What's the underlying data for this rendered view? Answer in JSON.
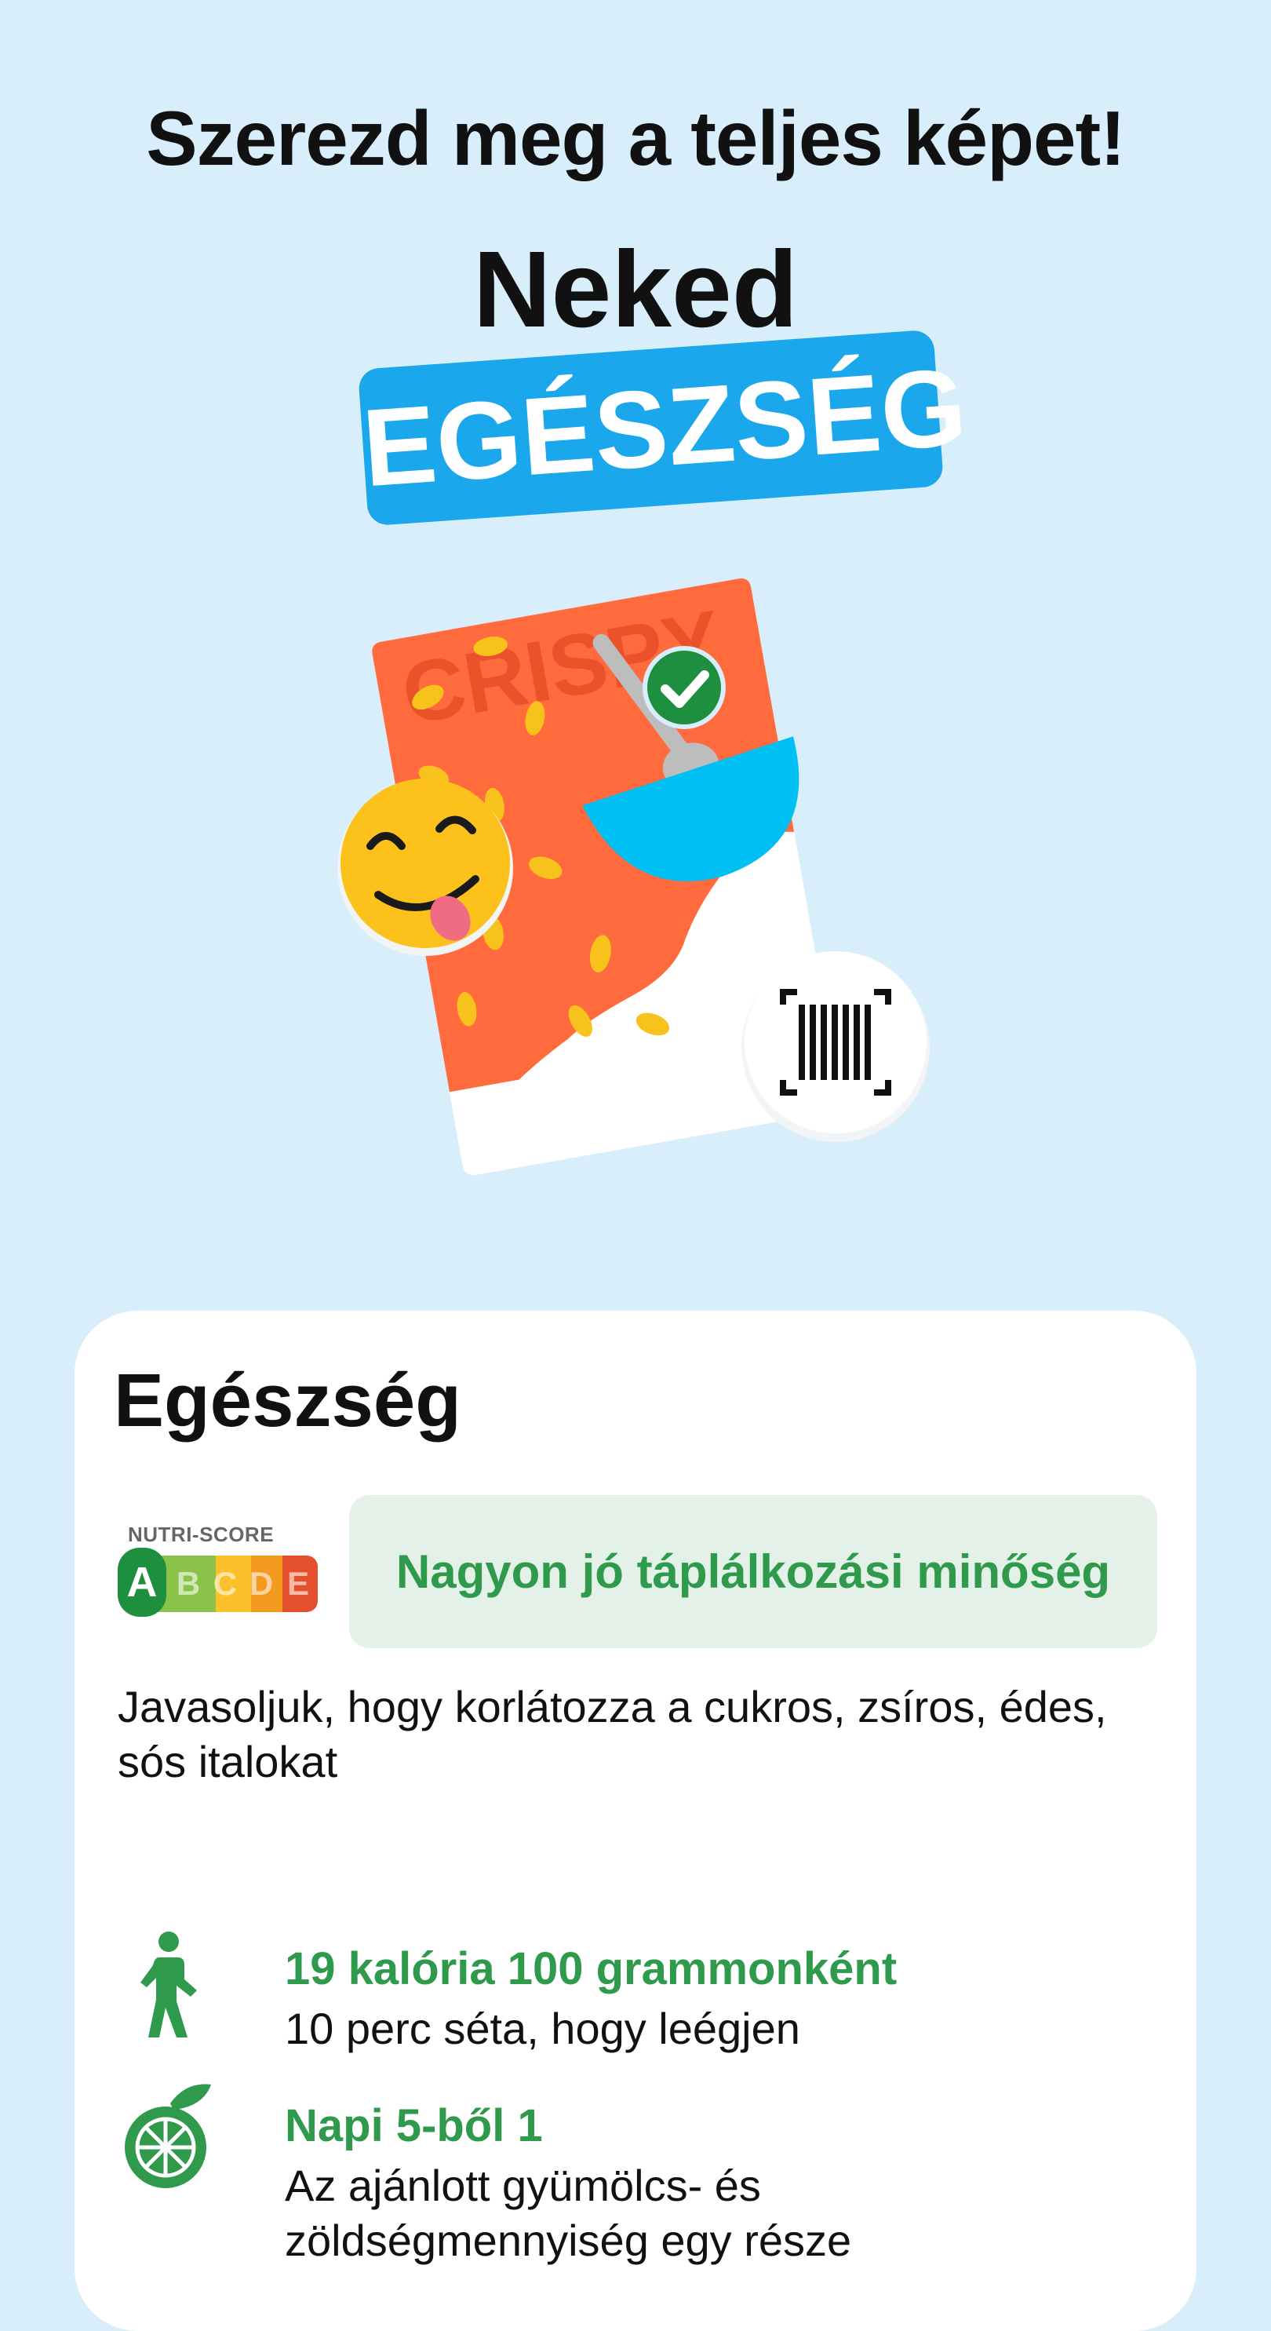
{
  "header": {
    "headline": "Szerezd meg a teljes képet!",
    "subtitle": "Neked",
    "highlight": "EGÉSZSÉG"
  },
  "illustration": {
    "package_text": "CRISPY",
    "icons": [
      "smiling-tongue-emoji-icon",
      "checkmark-icon",
      "barcode-scan-icon",
      "spoon-icon",
      "bowl-icon"
    ]
  },
  "card": {
    "title": "Egészség",
    "nutri_score": {
      "label": "NUTRI-SCORE",
      "grades": [
        "A",
        "B",
        "C",
        "D",
        "E"
      ],
      "selected": "A",
      "colors": [
        "#1e8f3e",
        "#8bc34a",
        "#fcc02d",
        "#f39a1f",
        "#e4502b"
      ]
    },
    "score_text": "Nagyon jó táplálkozási minőség",
    "advice": "Javasoljuk, hogy korlátozza a cukros, zsíros, édes, sós italokat",
    "rows": [
      {
        "icon": "walking-person-icon",
        "title": "19 kalória 100 grammonként",
        "text": "10 perc séta, hogy leégjen"
      },
      {
        "icon": "orange-fruit-icon",
        "title": "Napi 5-ből 1",
        "text": "Az ajánlott gyümölcs- és zöldségmennyiség egy része"
      }
    ]
  },
  "colors": {
    "background": "#d8effb",
    "accent_blue": "#1aa7ec",
    "green": "#2f9a4b",
    "package_orange": "#ff6b3d"
  }
}
